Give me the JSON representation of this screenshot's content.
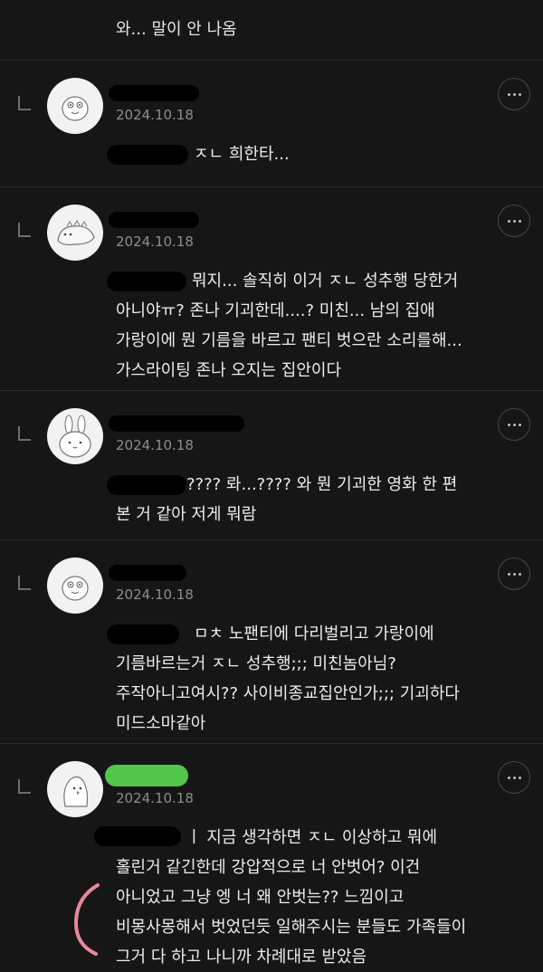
{
  "top_comment": {
    "text": "와... 말이 안 나옴"
  },
  "comments": [
    {
      "date": "2024.10.18",
      "text_lines": [
        "ㅈㄴ 희한타..."
      ],
      "avatar": "blob-face-icon"
    },
    {
      "date": "2024.10.18",
      "text_lines": [
        "뭐지... 솔직히 이거 ㅈㄴ 성추행 당한거",
        "아니야ㅠ? 존나 기괴한데....? 미친... 남의 집애",
        "가랑이에 뭔 기름을 바르고 팬티 벗으란 소리를해...",
        "가스라이팅 존나 오지는 집안이다"
      ],
      "avatar": "lizard-icon"
    },
    {
      "date": "2024.10.18",
      "text_lines": [
        "???? 롸...???? 와 뭔 기괴한 영화 한 편",
        "본 거 같아 저게 뭐람"
      ],
      "avatar": "bunny-icon"
    },
    {
      "date": "2024.10.18",
      "text_lines": [
        "ㅁㅊ 노팬티에 다리벌리고 가랑이에",
        "기름바르는거 ㅈㄴ 성추행;;; 미친놈아님?",
        "주작아니고여시?? 사이비종교집안인가;;; 기괴하다",
        "미드소마같아"
      ],
      "avatar": "blob-face-icon"
    },
    {
      "date": "2024.10.18",
      "text_lines": [
        "ㅣ 지금 생각하면 ㅈㄴ 이상하고 뭐에",
        "홀린거 같긴한데 강압적으로 너 안벗어? 이건",
        "아니었고 그냥 엥 너 왜 안벗는?? 느낌이고",
        "비몽사몽해서 벗었던듯 일해주시는 분들도 가족들이",
        "그거 다 하고 나니까 차례대로 받았음"
      ],
      "avatar": "ghost-bird-icon"
    }
  ],
  "colors": {
    "background": "#161616",
    "text": "#ececec",
    "date": "#8d8d8d",
    "redaction": "#000000",
    "highlight_green": "#52c64a",
    "annotation_pink": "#e8889a"
  }
}
